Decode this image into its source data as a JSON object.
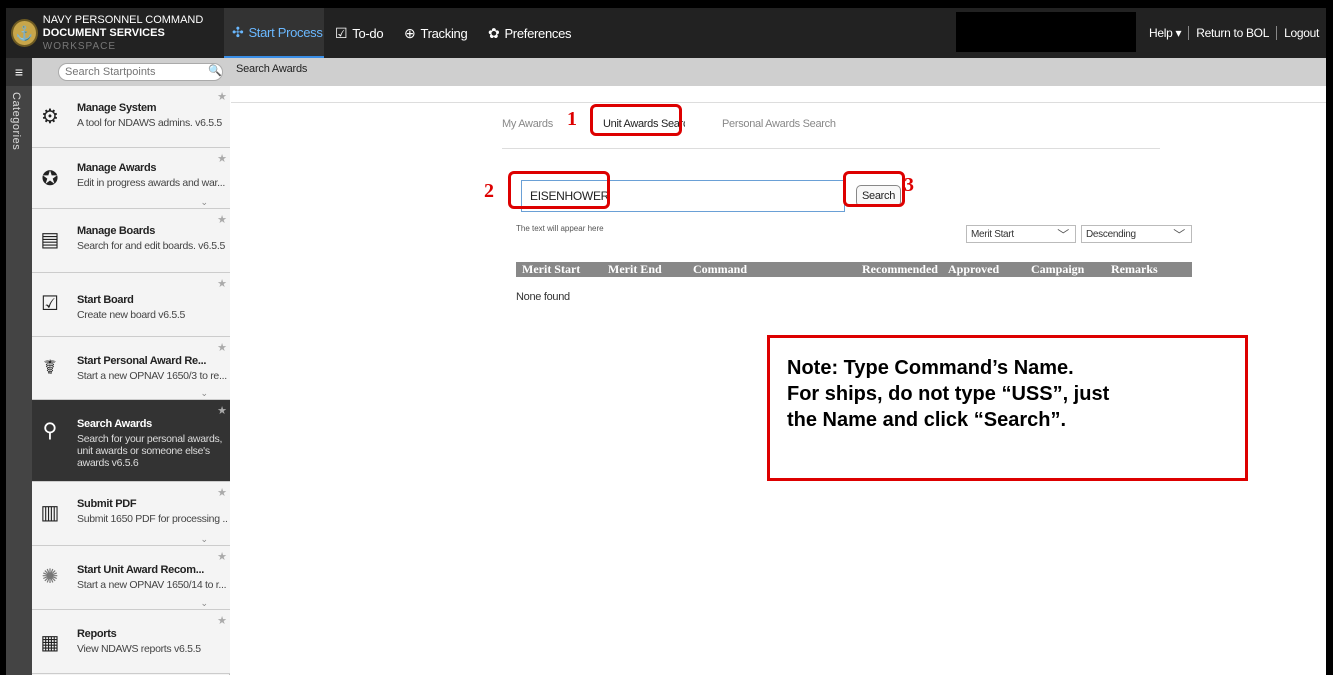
{
  "app": {
    "logo_line1": "NAVY PERSONNEL COMMAND",
    "logo_line2": "DOCUMENT SERVICES",
    "logo_line2b": "WORKSPACE"
  },
  "nav": {
    "start_process": "Start Process",
    "todo": "To-do",
    "tracking": "Tracking",
    "preferences": "Preferences",
    "help": "Help ▾",
    "return": "Return to BOL",
    "logout": "Logout"
  },
  "subbar": {
    "search_placeholder": "Search Startpoints",
    "breadcrumb": "Search Awards",
    "categories": "Categories"
  },
  "sidebar": {
    "items": [
      {
        "title": "Manage System",
        "desc": "A tool for NDAWS admins. v6.5.5"
      },
      {
        "title": "Manage Awards",
        "desc": "Edit in progress awards and war..."
      },
      {
        "title": "Manage Boards",
        "desc": "Search for and edit boards. v6.5.5"
      },
      {
        "title": "Start Board",
        "desc": "Create new board v6.5.5"
      },
      {
        "title": "Start Personal Award Re...",
        "desc": "Start a new OPNAV 1650/3 to re..."
      },
      {
        "title": "Search Awards",
        "desc": "Search for your personal awards, unit awards or someone else's awards v6.5.6"
      },
      {
        "title": "Submit PDF",
        "desc": "Submit 1650 PDF for processing ..."
      },
      {
        "title": "Start Unit Award Recom...",
        "desc": "Start a new OPNAV 1650/14 to r..."
      },
      {
        "title": "Reports",
        "desc": "View NDAWS reports v6.5.5"
      }
    ]
  },
  "award_tabs": {
    "my": "My Awards",
    "unit": "Unit Awards Search",
    "personal": "Personal Awards Search"
  },
  "search": {
    "value": "EISENHOWER",
    "button": "Search",
    "hint": "The text will appear here",
    "sort_field": "Merit Start",
    "sort_order": "Descending"
  },
  "table": {
    "columns": [
      "Merit Start",
      "Merit End",
      "Command",
      "Recommended",
      "Approved",
      "Campaign",
      "Remarks"
    ],
    "empty": "None found"
  },
  "annotations": {
    "n1": "1",
    "n2": "2",
    "n3": "3",
    "note_lines": [
      "Note:  Type Command’s Name.",
      "For ships, do not type “USS”, just",
      "the Name and click “Search”."
    ],
    "color": "#dd0000"
  }
}
